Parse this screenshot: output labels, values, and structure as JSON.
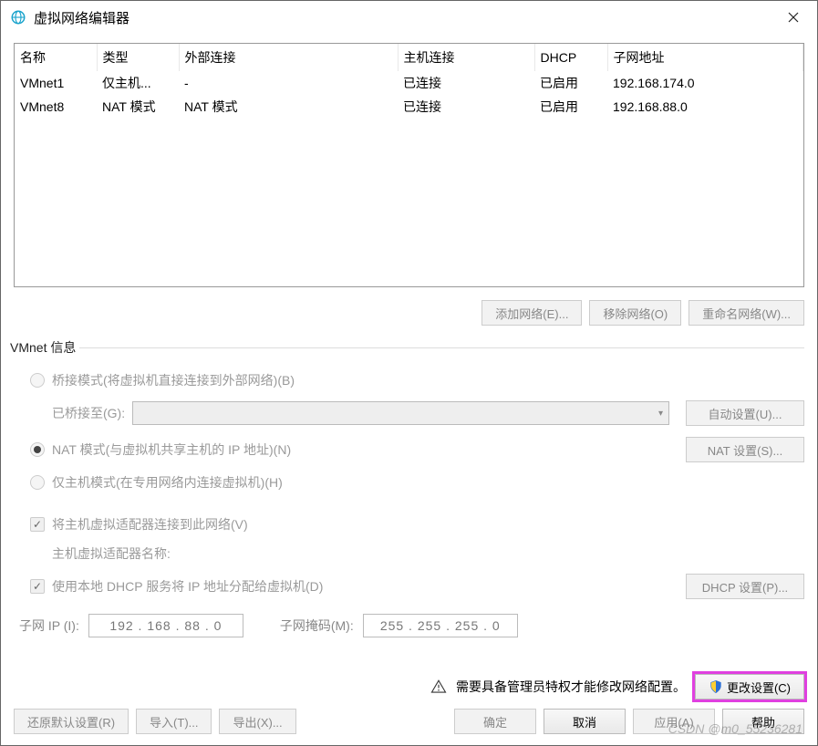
{
  "window": {
    "title": "虚拟网络编辑器"
  },
  "table": {
    "headers": {
      "name": "名称",
      "type": "类型",
      "ext": "外部连接",
      "host": "主机连接",
      "dhcp": "DHCP",
      "subnet": "子网地址"
    },
    "rows": [
      {
        "name": "VMnet1",
        "type": "仅主机...",
        "ext": "-",
        "host": "已连接",
        "dhcp": "已启用",
        "subnet": "192.168.174.0"
      },
      {
        "name": "VMnet8",
        "type": "NAT 模式",
        "ext": "NAT 模式",
        "host": "已连接",
        "dhcp": "已启用",
        "subnet": "192.168.88.0"
      }
    ]
  },
  "net_buttons": {
    "add": "添加网络(E)...",
    "remove": "移除网络(O)",
    "rename": "重命名网络(W)..."
  },
  "vmnet_info": {
    "legend": "VMnet 信息",
    "bridge_radio": "桥接模式(将虚拟机直接连接到外部网络)(B)",
    "bridge_to_label": "已桥接至(G):",
    "auto_btn": "自动设置(U)...",
    "nat_radio": "NAT 模式(与虚拟机共享主机的 IP 地址)(N)",
    "nat_btn": "NAT 设置(S)...",
    "hostonly_radio": "仅主机模式(在专用网络内连接虚拟机)(H)",
    "connect_host_check": "将主机虚拟适配器连接到此网络(V)",
    "adapter_name_label": "主机虚拟适配器名称:",
    "dhcp_check": "使用本地 DHCP 服务将 IP 地址分配给虚拟机(D)",
    "dhcp_btn": "DHCP 设置(P)...",
    "subnet_ip_label": "子网 IP (I):",
    "subnet_ip_value": "192 . 168 .  88  .   0",
    "subnet_mask_label": "子网掩码(M):",
    "subnet_mask_value": "255 . 255 . 255 .   0"
  },
  "admin": {
    "message": "需要具备管理员特权才能修改网络配置。",
    "change_btn": "更改设置(C)"
  },
  "footer": {
    "restore": "还原默认设置(R)",
    "import": "导入(T)...",
    "export": "导出(X)...",
    "ok": "确定",
    "cancel": "取消",
    "apply": "应用(A)",
    "help": "帮助"
  },
  "watermark": "CSDN @m0_55236281"
}
